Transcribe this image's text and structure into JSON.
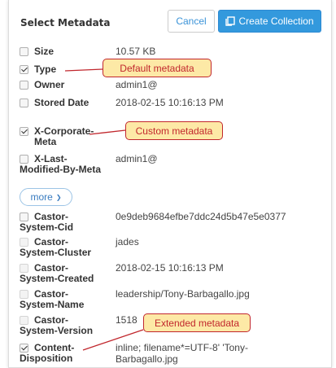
{
  "header": {
    "title": "Select Metadata",
    "cancel_label": "Cancel",
    "create_label": "Create Collection",
    "create_icon": "copy-icon"
  },
  "more": {
    "label": "more",
    "icon": "chevron-down-icon"
  },
  "rows": [
    {
      "name": "Size",
      "value": "10.57 KB",
      "checked": false
    },
    {
      "name": "Type",
      "value": "",
      "checked": true
    },
    {
      "name": "Owner",
      "value": "admin1@",
      "checked": false
    },
    {
      "name": "Stored Date",
      "value": "2018-02-15 10:16:13 PM",
      "checked": false
    },
    {
      "name": "X-Corporate-Meta",
      "value": "",
      "checked": true
    },
    {
      "name": "X-Last-Modified-By-Meta",
      "value": "admin1@",
      "checked": false
    },
    {
      "name": "Castor-System-Cid",
      "value": "0e9deb9684efbe7ddc24d5b47e5e0377",
      "checked": false
    },
    {
      "name": "Castor-System-Cluster",
      "value": "jades",
      "checked": false
    },
    {
      "name": "Castor-System-Created",
      "value": "2018-02-15 10:16:13 PM",
      "checked": false
    },
    {
      "name": "Castor-System-Name",
      "value": "leadership/Tony-Barbagallo.jpg",
      "checked": false
    },
    {
      "name": "Castor-System-Version",
      "value": "1518",
      "checked": false
    },
    {
      "name": "Content-Disposition",
      "value": "inline; filename*=UTF-8' 'Tony-Barbagallo.jpg",
      "checked": true
    }
  ],
  "callouts": {
    "default": "Default metadata",
    "custom": "Custom metadata",
    "extended": "Extended metadata"
  },
  "colors": {
    "primary": "#3399dd",
    "callout_border": "#c1272d",
    "callout_fill": "#fde9a6"
  }
}
